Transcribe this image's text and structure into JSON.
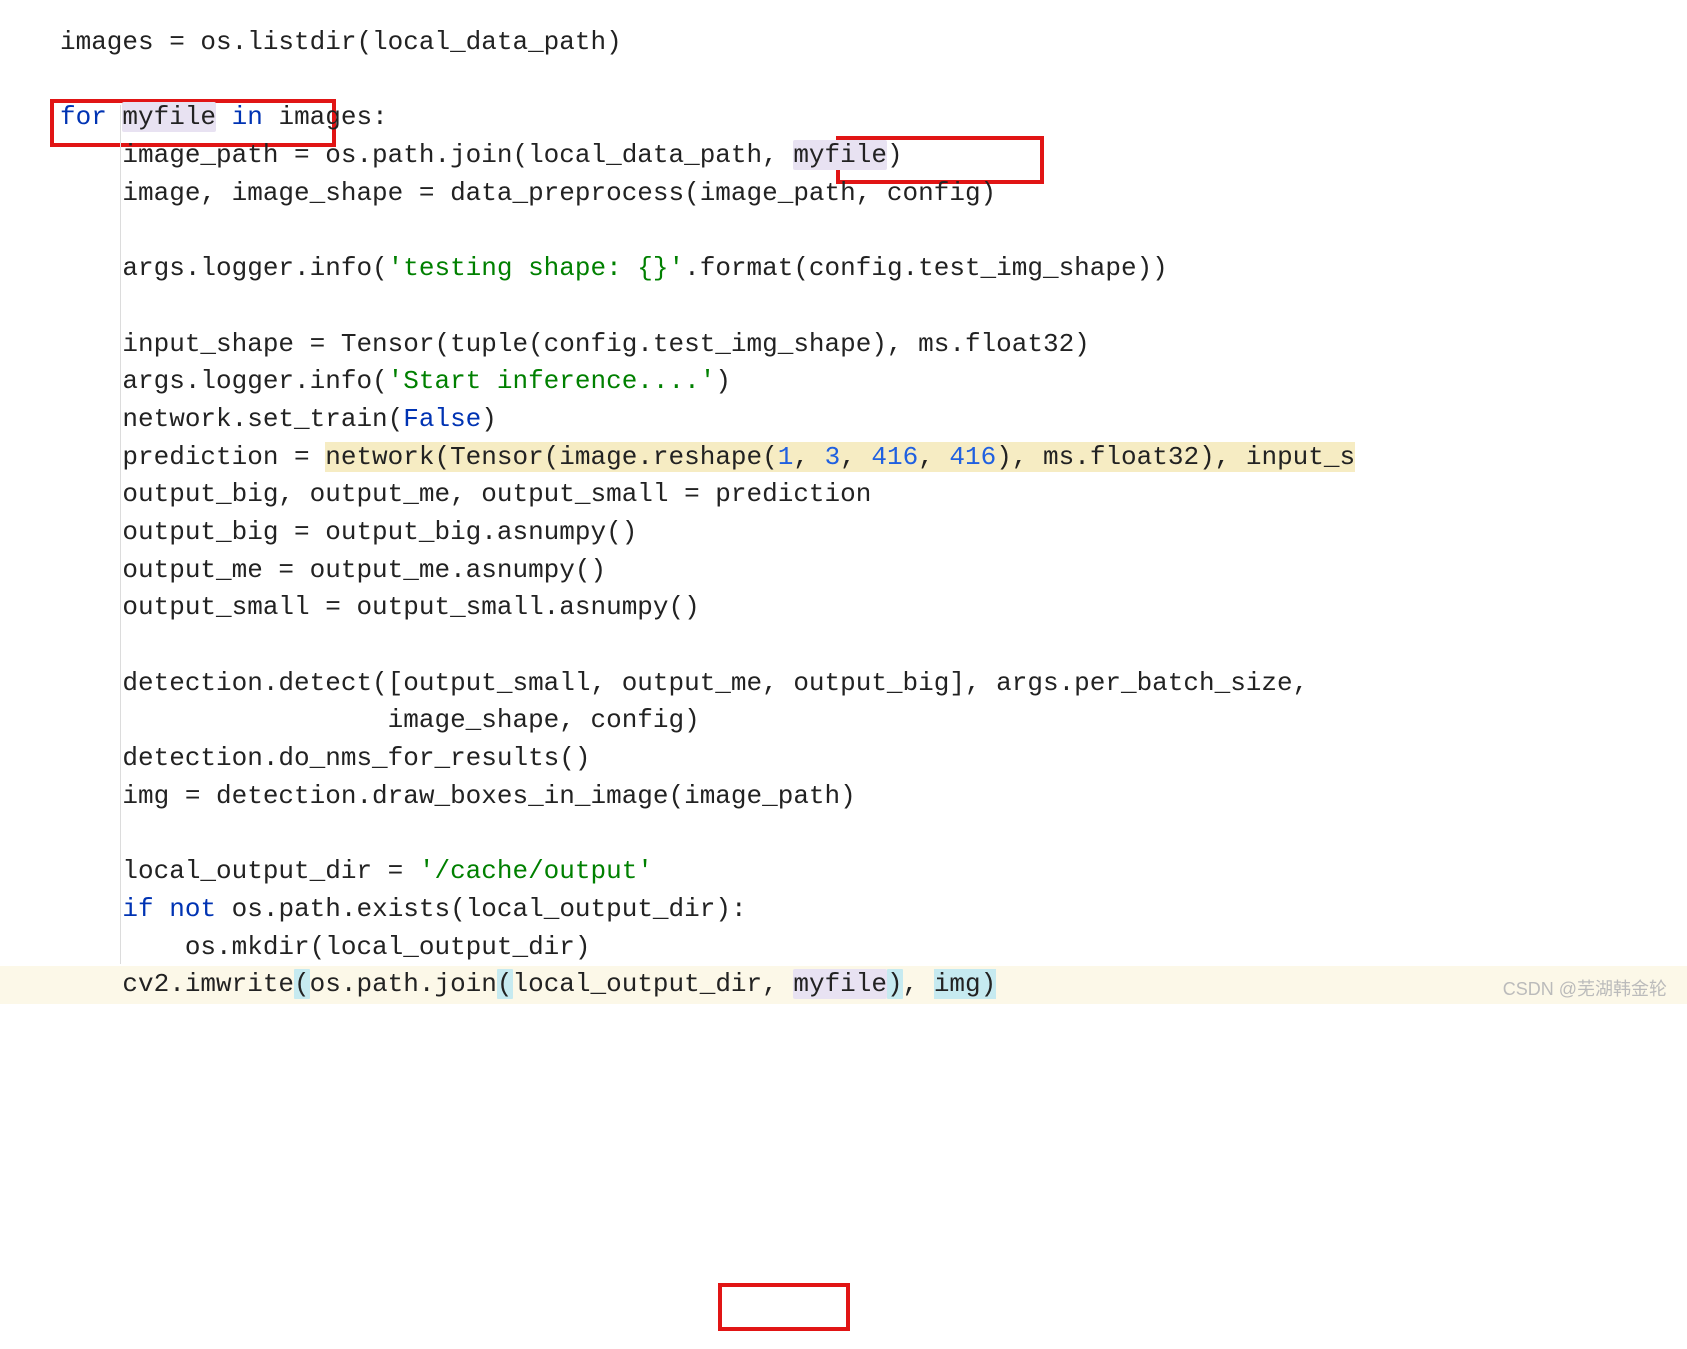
{
  "watermark": "CSDN @芜湖韩金轮",
  "keywords": {
    "for": "for",
    "in": "in",
    "if": "if",
    "not": "not",
    "false": "False"
  },
  "strings": {
    "testing_shape": "'testing shape: {}'",
    "start_inference": "'Start inference....'",
    "cache_output": "'/cache/output'"
  },
  "numbers": {
    "n1": "1",
    "n3": "3",
    "n416a": "416",
    "n416b": "416"
  },
  "code": {
    "l1": "images = os.listdir(local_data_path)",
    "l2": "",
    "l3_a": " ",
    "l3_myfile": "myfile",
    "l3_b": " ",
    "l3_c": " images",
    "l3_colon": ":",
    "l4_a": "    image_path = os.path.join(local_data_path, ",
    "l4_myfile": "myfile",
    "l4_b": ")",
    "l5": "    image, image_shape = data_preprocess(image_path, config)",
    "l6": "",
    "l7_a": "    args.logger.info(",
    "l7_b": ".format(config.test_img_shape))",
    "l8": "",
    "l9": "    input_shape = Tensor(tuple(config.test_img_shape), ms.float32)",
    "l10_a": "    args.logger.info(",
    "l10_b": ")",
    "l11_a": "    network.set_train(",
    "l11_b": ")",
    "l12_a": "    prediction = ",
    "l12_b": "network(Tensor(image.reshape(",
    "l12_c": ", ",
    "l12_d": ", ",
    "l12_e": ", ",
    "l12_f": "), ms.float32), input_s",
    "l13": "    output_big, output_me, output_small = prediction",
    "l14": "    output_big = output_big.asnumpy()",
    "l15": "    output_me = output_me.asnumpy()",
    "l16": "    output_small = output_small.asnumpy()",
    "l17": "",
    "l18": "    detection.detect([output_small, output_me, output_big], args.per_batch_size,",
    "l19": "                     image_shape, config)",
    "l20": "    detection.do_nms_for_results()",
    "l21": "    img = detection.draw_boxes_in_image(image_path)",
    "l22": "",
    "l23_a": "    local_output_dir = ",
    "l24_a": "    ",
    "l24_b": " ",
    "l24_c": " os.path.exists(local_output_dir):",
    "l25": "        os.mkdir(local_output_dir)",
    "l26_a": "    cv2.imwrite",
    "l26_p1": "(",
    "l26_b": "os.path.join",
    "l26_p2": "(",
    "l26_c": "local_output_dir, ",
    "l26_myfile": "myfile",
    "l26_p3": ")",
    "l26_d": ", ",
    "l26_e": "img)"
  }
}
